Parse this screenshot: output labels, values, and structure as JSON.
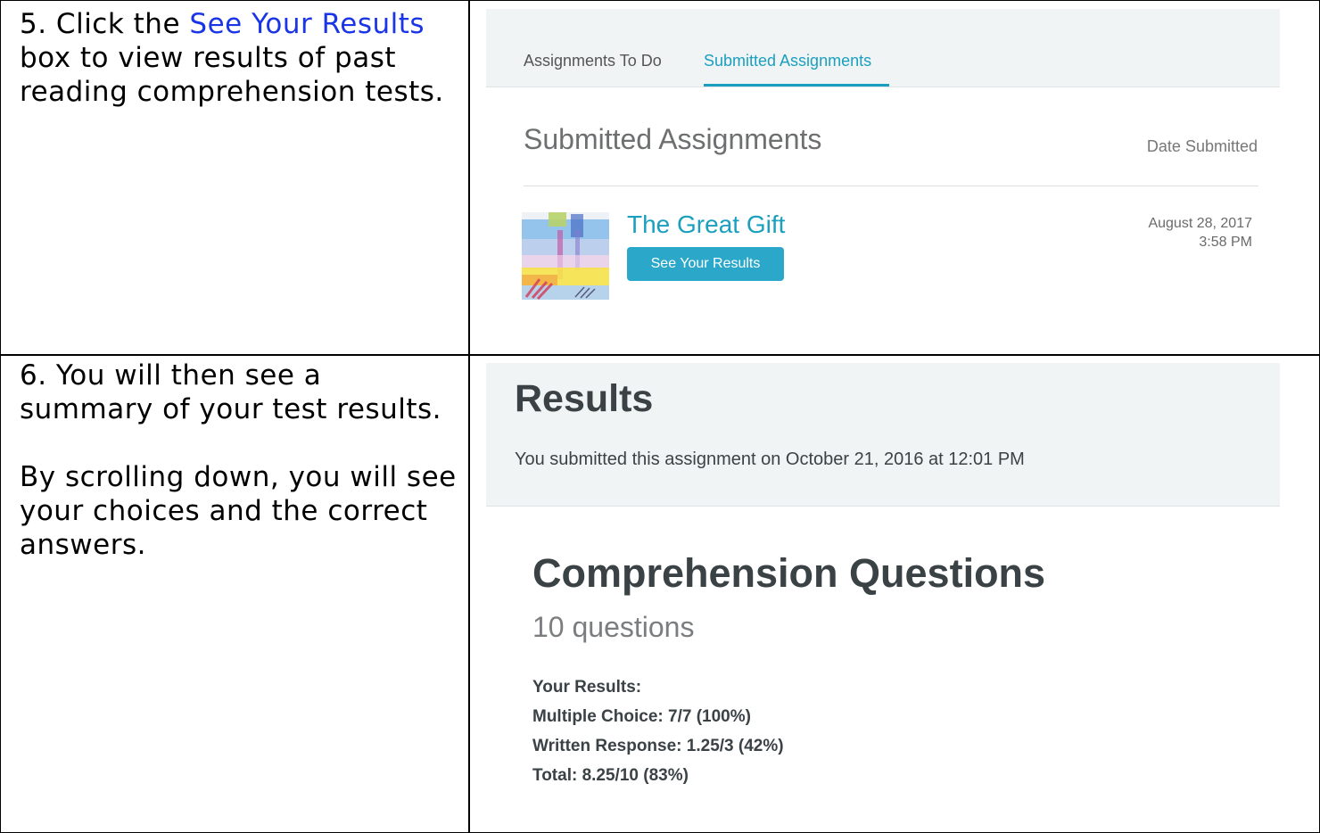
{
  "step5": {
    "prefix": "5. Click the ",
    "link": "See Your Results",
    "suffix": " box to view results of past reading comprehension tests."
  },
  "step6": {
    "line1": "6. You will then see a summary of your test results.",
    "line2": "By scrolling down, you will see your choices and the correct answers."
  },
  "assignments": {
    "tabs": [
      "Assignments To Do",
      "Submitted Assignments"
    ],
    "active_tab": "Submitted Assignments",
    "section_title": "Submitted Assignments",
    "date_header": "Date Submitted",
    "item": {
      "title": "The Great Gift",
      "button": "See Your Results",
      "date": "August 28, 2017",
      "time": "3:58 PM"
    }
  },
  "results": {
    "title": "Results",
    "submitted_text": "You submitted this assignment on October 21, 2016 at 12:01 PM",
    "section_title": "Comprehension Questions",
    "question_count": "10 questions",
    "your_results": "Your Results:",
    "multiple_choice": "Multiple Choice: 7/7 (100%)",
    "written_response": "Written Response: 1.25/3 (42%)",
    "total": "Total: 8.25/10 (83%)"
  },
  "colors": {
    "accent": "#1a9fbf",
    "button": "#2aa7c9",
    "instruction_link": "#1a35e6"
  }
}
